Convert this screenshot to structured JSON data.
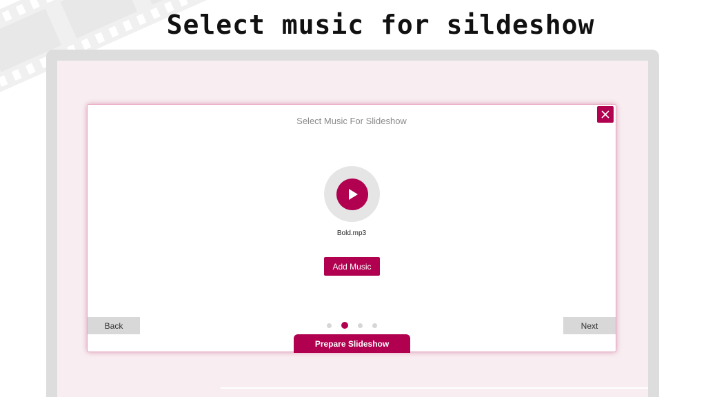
{
  "headline": "Select music for sildeshow",
  "dialog": {
    "title": "Select Music For Slideshow",
    "close_icon": "close-icon",
    "play_icon": "play-icon",
    "file_name": "Bold.mp3",
    "add_music_label": "Add Music",
    "back_label": "Back",
    "next_label": "Next",
    "prepare_label": "Prepare Slideshow",
    "steps_total": 4,
    "active_step": 2
  },
  "colors": {
    "accent": "#b0004f",
    "screen_bg": "#f8eef1",
    "frame": "#dddddd",
    "play_ring": "#e5e5e5",
    "nav_button": "#d8d8d8"
  }
}
